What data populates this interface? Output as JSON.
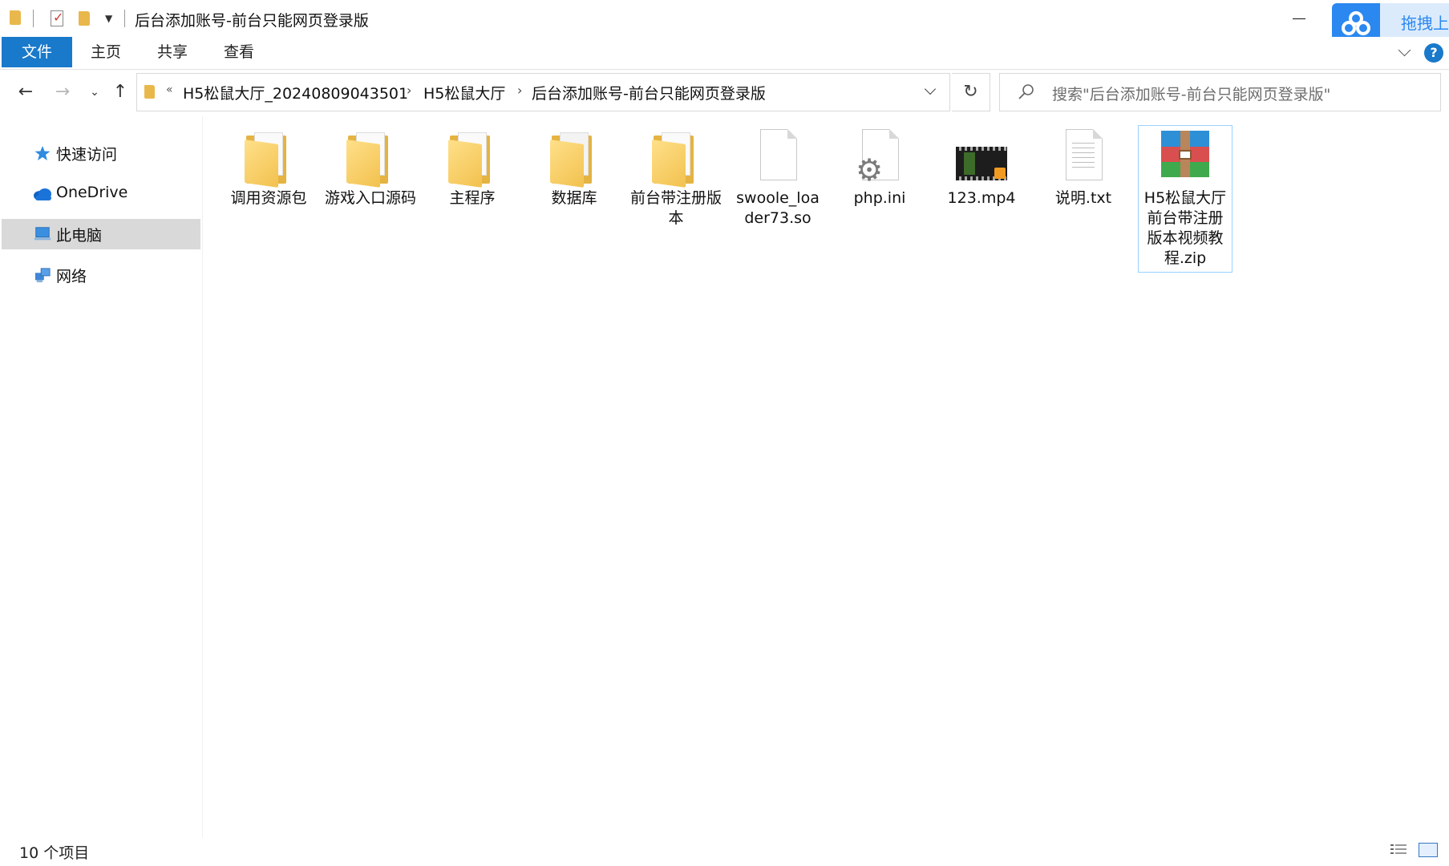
{
  "window": {
    "title": "后台添加账号-前台只能网页登录版",
    "drag_upload": "拖拽上"
  },
  "ribbon": {
    "tabs": [
      "文件",
      "主页",
      "共享",
      "查看"
    ]
  },
  "address": {
    "overflow": "«",
    "crumbs": [
      "H5松鼠大厅_20240809043501",
      "H5松鼠大厅",
      "后台添加账号-前台只能网页登录版"
    ]
  },
  "search": {
    "placeholder": "搜索\"后台添加账号-前台只能网页登录版\""
  },
  "sidebar": {
    "items": [
      {
        "label": "快速访问",
        "icon": "star-icon"
      },
      {
        "label": "OneDrive",
        "icon": "cloud-icon"
      },
      {
        "label": "此电脑",
        "icon": "computer-icon",
        "selected": true
      },
      {
        "label": "网络",
        "icon": "network-icon"
      }
    ]
  },
  "files": [
    {
      "name": "调用资源包",
      "type": "folder"
    },
    {
      "name": "游戏入口源码",
      "type": "folder"
    },
    {
      "name": "主程序",
      "type": "folder"
    },
    {
      "name": "数据库",
      "type": "folder-doc"
    },
    {
      "name": "前台带注册版本",
      "type": "folder"
    },
    {
      "name": "swoole_loader73.so",
      "type": "file"
    },
    {
      "name": "php.ini",
      "type": "config"
    },
    {
      "name": "123.mp4",
      "type": "video"
    },
    {
      "name": "说明.txt",
      "type": "text"
    },
    {
      "name": "H5松鼠大厅前台带注册版本视频教程.zip",
      "type": "zip",
      "selected": true
    }
  ],
  "status": {
    "count": "10 个项目"
  },
  "colors": {
    "accent": "#1979ca",
    "folder": "#f2c14e",
    "selection_border": "#99d1ff",
    "baidu": "#2b88f0"
  }
}
